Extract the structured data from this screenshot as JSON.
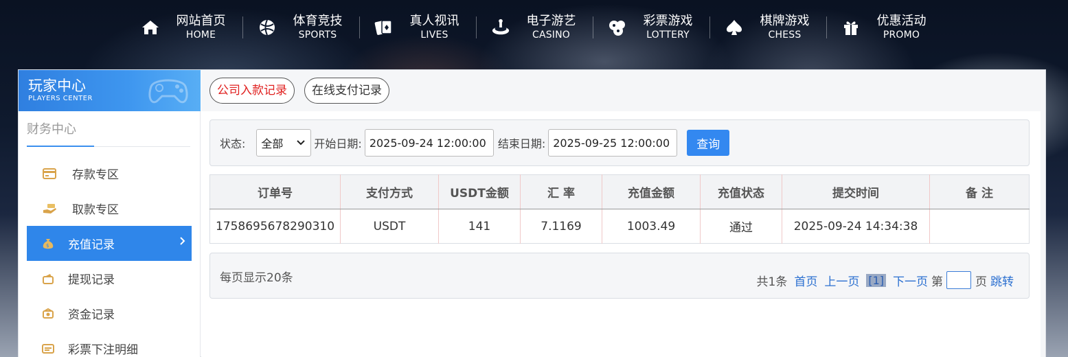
{
  "nav": [
    {
      "cn": "网站首页",
      "en": "HOME",
      "icon": "home-icon"
    },
    {
      "cn": "体育竞技",
      "en": "SPORTS",
      "icon": "basketball-icon"
    },
    {
      "cn": "真人视讯",
      "en": "LIVES",
      "icon": "cards-icon"
    },
    {
      "cn": "电子游艺",
      "en": "CASINO",
      "icon": "slot-icon"
    },
    {
      "cn": "彩票游戏",
      "en": "LOTTERY",
      "icon": "lottery-balls-icon"
    },
    {
      "cn": "棋牌游戏",
      "en": "CHESS",
      "icon": "spade-icon"
    },
    {
      "cn": "优惠活动",
      "en": "PROMO",
      "icon": "gift-icon"
    }
  ],
  "sidebar": {
    "title_cn": "玩家中心",
    "title_en": "PLAYERS CENTER",
    "section": "财务中心",
    "items": [
      {
        "label": "存款专区",
        "icon": "deposit-card-icon",
        "active": false
      },
      {
        "label": "取款专区",
        "icon": "withdraw-hand-icon",
        "active": false
      },
      {
        "label": "充值记录",
        "icon": "money-bag-icon",
        "active": true
      },
      {
        "label": "提现记录",
        "icon": "wallet-icon",
        "active": false
      },
      {
        "label": "资金记录",
        "icon": "cash-icon",
        "active": false
      },
      {
        "label": "彩票下注明细",
        "icon": "ticket-icon",
        "active": false
      }
    ]
  },
  "tabs": [
    {
      "label": "公司入款记录",
      "active": true
    },
    {
      "label": "在线支付记录",
      "active": false
    }
  ],
  "filter": {
    "status_label": "状态:",
    "status_value": "全部",
    "start_label": "开始日期:",
    "start_value": "2025-09-24 12:00:00",
    "end_label": "结束日期:",
    "end_value": "2025-09-25 12:00:00",
    "query_label": "查询"
  },
  "table": {
    "headers": [
      "订单号",
      "支付方式",
      "USDT金额",
      "汇 率",
      "充值金额",
      "充值状态",
      "提交时间",
      "备 注"
    ],
    "rows": [
      [
        "1758695678290310",
        "USDT",
        "141",
        "7.1169",
        "1003.49",
        "通过",
        "2025-09-24 14:34:38",
        ""
      ]
    ]
  },
  "pager": {
    "per_page": "每页显示20条",
    "total": "共1条",
    "first": "首页",
    "prev": "上一页",
    "current": "[1]",
    "next": "下一页",
    "page_prefix": "第",
    "page_suffix": "页",
    "jump": "跳转"
  },
  "colors": {
    "accent": "#2f86ea",
    "active_tab_text": "#e0201f",
    "link": "#2a6fd0"
  }
}
